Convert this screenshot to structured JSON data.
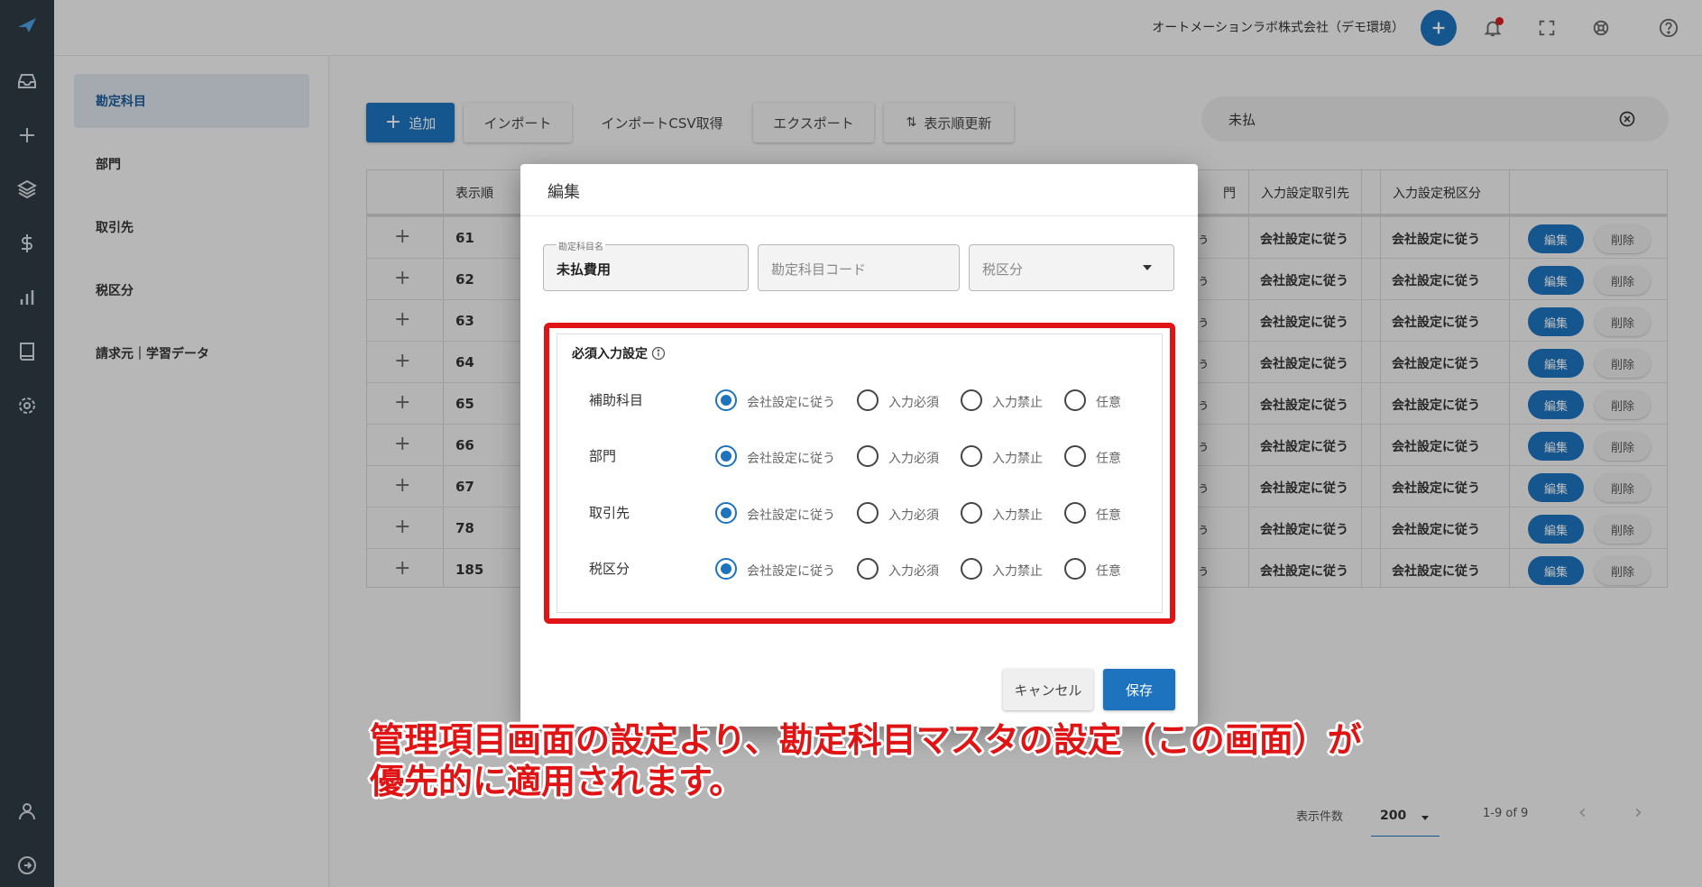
{
  "topbar": {
    "company": "オートメーションラボ株式会社（デモ環境）"
  },
  "sidebar": {
    "items": [
      {
        "label": "勘定科目",
        "active": true
      },
      {
        "label": "部門"
      },
      {
        "label": "取引先"
      },
      {
        "label": "税区分"
      },
      {
        "label": "請求元｜学習データ"
      }
    ]
  },
  "toolbar": {
    "add": "追加",
    "import": "インポート",
    "import_csv": "インポートCSV取得",
    "export": "エクスポート",
    "reorder": "表示順更新"
  },
  "search": {
    "value": "未払"
  },
  "table": {
    "headers": {
      "order": "表示順",
      "c1": "門",
      "c2": "入力設定取引先",
      "c3": "入力設定税区分"
    },
    "rows": [
      {
        "order": "61",
        "c1": "ぅ",
        "c2": "会社設定に従う",
        "c3": "会社設定に従う"
      },
      {
        "order": "62",
        "c1": "ぅ",
        "c2": "会社設定に従う",
        "c3": "会社設定に従う"
      },
      {
        "order": "63",
        "c1": "ぅ",
        "c2": "会社設定に従う",
        "c3": "会社設定に従う"
      },
      {
        "order": "64",
        "c1": "ぅ",
        "c2": "会社設定に従う",
        "c3": "会社設定に従う"
      },
      {
        "order": "65",
        "c1": "ぅ",
        "c2": "会社設定に従う",
        "c3": "会社設定に従う"
      },
      {
        "order": "66",
        "c1": "ぅ",
        "c2": "会社設定に従う",
        "c3": "会社設定に従う"
      },
      {
        "order": "67",
        "c1": "ぅ",
        "c2": "会社設定に従う",
        "c3": "会社設定に従う"
      },
      {
        "order": "78",
        "c1": "ぅ",
        "c2": "会社設定に従う",
        "c3": "会社設定に従う"
      },
      {
        "order": "185",
        "c1": "ぅ",
        "c2": "会社設定に従う",
        "c3": "会社設定に従う"
      }
    ],
    "edit_label": "編集",
    "delete_label": "削除"
  },
  "pager": {
    "label": "表示件数",
    "per_page": "200",
    "range": "1-9 of 9"
  },
  "modal": {
    "title": "編集",
    "name_label": "勘定科目名",
    "name_value": "未払費用",
    "code_placeholder": "勘定科目コード",
    "tax_placeholder": "税区分",
    "required_title": "必須入力設定",
    "options": [
      "会社設定に従う",
      "入力必須",
      "入力禁止",
      "任意"
    ],
    "rows": [
      {
        "label": "補助科目",
        "selected": 0
      },
      {
        "label": "部門",
        "selected": 0
      },
      {
        "label": "取引先",
        "selected": 0
      },
      {
        "label": "税区分",
        "selected": 0
      }
    ],
    "cancel": "キャンセル",
    "save": "保存"
  },
  "callout": {
    "line1": "管理項目画面の設定より、勘定科目マスタの設定（この画面）が",
    "line2": "優先的に適用されます。"
  },
  "colors": {
    "accent": "#1e73be",
    "callout": "#e01414",
    "rail": "#2f3a44"
  }
}
